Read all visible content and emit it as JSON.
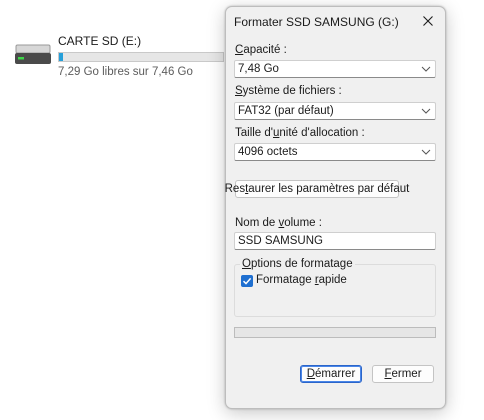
{
  "drive": {
    "name": "CARTE SD (E:)",
    "free_text": "7,29 Go libres sur 7,46 Go",
    "used_fraction": 0.023,
    "bar_color": "#26a0da"
  },
  "dialog": {
    "title": "Formater SSD SAMSUNG (G:)",
    "close_icon": "close-icon",
    "capacity": {
      "label_prefix": "",
      "label_accel": "C",
      "label_rest": "apacité :",
      "value": "7,48 Go"
    },
    "filesystem": {
      "label_prefix": "",
      "label_accel": "S",
      "label_rest": "ystème de fichiers :",
      "value": "FAT32 (par défaut)"
    },
    "allocation": {
      "label_prefix": "Taille d'",
      "label_accel": "u",
      "label_rest": "nité d'allocation :",
      "value": "4096 octets"
    },
    "restore_button": {
      "prefix": "Res",
      "accel": "t",
      "rest": "aurer les paramètres par défaut"
    },
    "volume_name": {
      "label_prefix": "Nom de ",
      "label_accel": "v",
      "label_rest": "olume :",
      "value": "SSD SAMSUNG"
    },
    "format_options": {
      "title_prefix": "",
      "title_accel": "O",
      "title_rest": "ptions de formatage",
      "quick_format": {
        "label_prefix": "Formatage ",
        "label_accel": "r",
        "label_rest": "apide",
        "checked": true
      }
    },
    "progress": {
      "value": 0,
      "fill_color": "#06b025"
    },
    "start_button": {
      "prefix": "",
      "accel": "D",
      "rest": "émarrer"
    },
    "close_button": {
      "prefix": "",
      "accel": "F",
      "rest": "ermer"
    },
    "accent_color": "#1f6fd0"
  }
}
